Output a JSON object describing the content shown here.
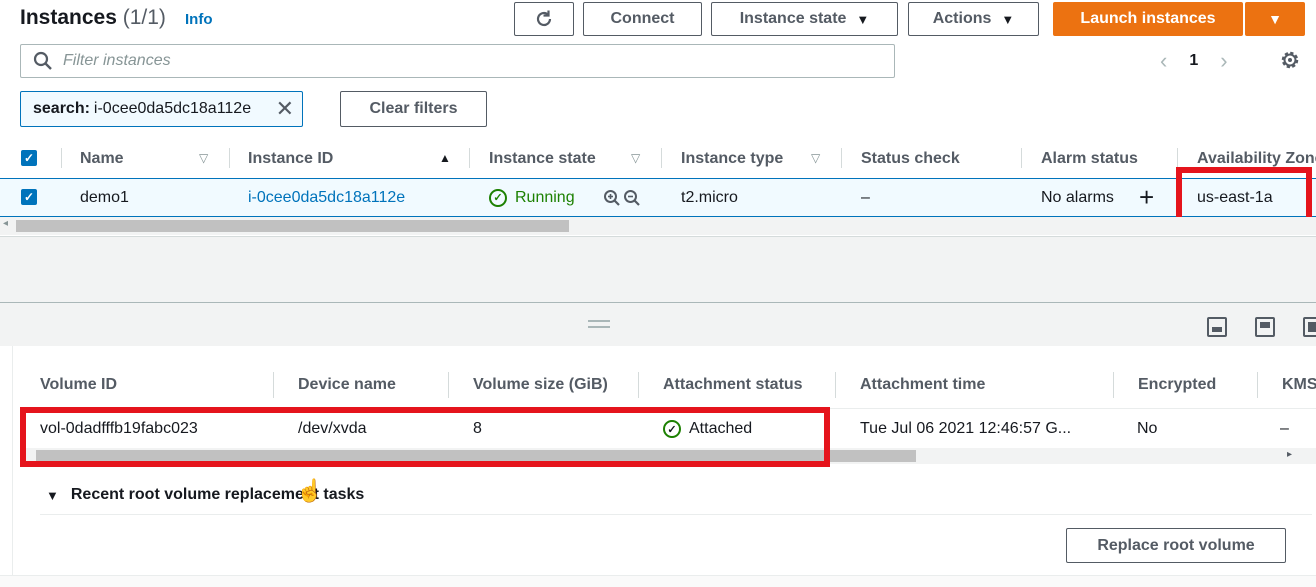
{
  "header": {
    "title": "Instances",
    "count": "(1/1)",
    "info": "Info"
  },
  "toolbar": {
    "refresh_icon": "refresh-icon",
    "connect": "Connect",
    "instance_state": "Instance state",
    "actions": "Actions",
    "launch": "Launch instances",
    "caret": "▼"
  },
  "filter": {
    "placeholder": "Filter instances",
    "value": "",
    "token_key": "search:",
    "token_value": "i-0cee0da5dc18a112e",
    "clear": "Clear filters"
  },
  "pagination": {
    "prev": "‹",
    "page": "1",
    "next": "›"
  },
  "instances_table": {
    "columns": [
      "Name",
      "Instance ID",
      "Instance state",
      "Instance type",
      "Status check",
      "Alarm status",
      "Availability Zone"
    ],
    "rows": [
      {
        "selected": true,
        "name": "demo1",
        "instance_id": "i-0cee0da5dc18a112e",
        "state": "Running",
        "type": "t2.micro",
        "status_check": "–",
        "alarm_status": "No alarms",
        "availability_zone": "us-east-1a"
      }
    ]
  },
  "storage_table": {
    "columns": [
      "Volume ID",
      "Device name",
      "Volume size (GiB)",
      "Attachment status",
      "Attachment time",
      "Encrypted",
      "KMS"
    ],
    "rows": [
      {
        "volume_id": "vol-0dadfffb19fabc023",
        "device_name": "/dev/xvda",
        "size": "8",
        "attachment_status": "Attached",
        "attachment_time": "Tue Jul 06 2021 12:46:57 G...",
        "encrypted": "No",
        "kms": "–"
      }
    ]
  },
  "replace_section": {
    "title": "Recent root volume replacement tasks",
    "button": "Replace root volume"
  },
  "colors": {
    "accent": "#0073bb",
    "primary_button": "#ec7211",
    "success": "#1d8102",
    "highlight_box": "#e5141c"
  }
}
